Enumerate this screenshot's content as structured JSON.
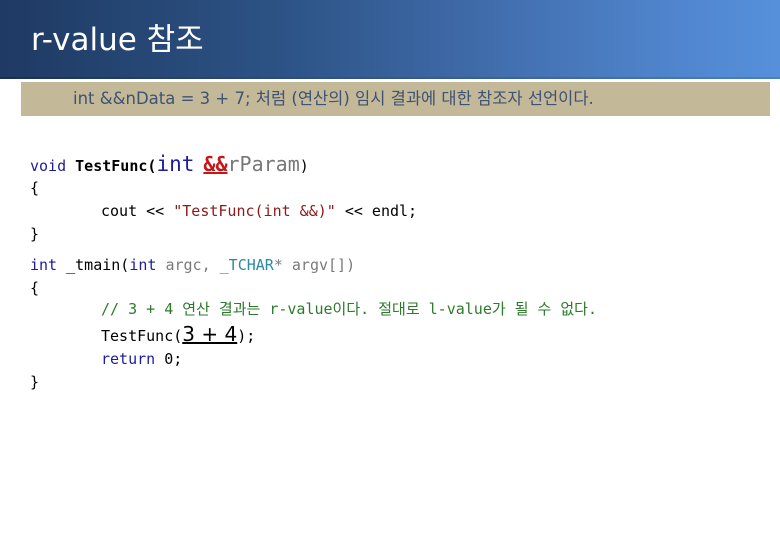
{
  "slide": {
    "title": "r-value 참조",
    "note": "int &&nData = 3 + 7; 처럼 (연산의) 임시 결과에 대한 참조자 선언이다.",
    "colors": {
      "title_gradient_start": "#1f3a63",
      "title_gradient_end": "#5690db",
      "note_background": "#c3b897",
      "note_text": "#3e5274",
      "keyword": "#1c1c9e",
      "rvalue_ref": "#c41818",
      "string": "#8a1a1a",
      "comment": "#2c7a2c",
      "type": "#2b8aa6"
    }
  },
  "code": {
    "func_def": {
      "ret_type": "void",
      "name": "TestFunc(",
      "param_type": "int",
      "ref_op": "&&",
      "param_name": "rParam",
      "close": ")"
    },
    "open_brace_1": "{",
    "cout_line": {
      "cout": "cout << ",
      "string": "\"TestFunc(int &&)\"",
      "rest": " << endl;"
    },
    "close_brace_1": "}",
    "main_sig": {
      "ret_type": "int",
      "name": " _tmain(",
      "arg1_type": "int",
      "arg1_name": " argc, ",
      "arg2_type": "_TCHAR",
      "arg2_rest": "* argv[])"
    },
    "open_brace_2": "{",
    "comment_line": "// 3 + 4 연산 결과는 r-value이다. 절대로 l-value가 될 수 없다.",
    "call_line": {
      "name": "TestFunc(",
      "arg": "3 + 4",
      "close": ");"
    },
    "return_line": {
      "keyword": "return",
      "value": " 0;"
    },
    "close_brace_2": "}"
  }
}
